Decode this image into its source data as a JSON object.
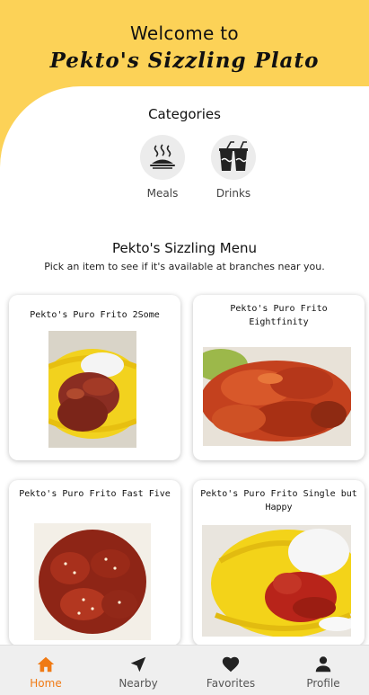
{
  "header": {
    "welcome": "Welcome to",
    "brand": "Pekto's Sizzling Plato"
  },
  "categories": {
    "title": "Categories",
    "items": [
      {
        "label": "Meals",
        "icon": "hot-plate-icon"
      },
      {
        "label": "Drinks",
        "icon": "drinks-icon"
      }
    ]
  },
  "menu": {
    "title": "Pekto's Sizzling Menu",
    "subtitle": "Pick an item to see if it's available at branches near you.",
    "items": [
      {
        "name": "Pekto's Puro Frito 2Some"
      },
      {
        "name": "Pekto's Puro Frito Eightfinity"
      },
      {
        "name": "Pekto's Puro Frito Fast Five"
      },
      {
        "name": "Pekto's Puro Frito Single but Happy"
      }
    ]
  },
  "nav": {
    "items": [
      {
        "label": "Home",
        "icon": "home-icon",
        "active": true
      },
      {
        "label": "Nearby",
        "icon": "navigation-arrow-icon",
        "active": false
      },
      {
        "label": "Favorites",
        "icon": "heart-icon",
        "active": false
      },
      {
        "label": "Profile",
        "icon": "person-icon",
        "active": false
      }
    ],
    "active_color": "#f07a14"
  },
  "colors": {
    "header_yellow": "#fcd257",
    "accent_orange": "#f07a14"
  }
}
